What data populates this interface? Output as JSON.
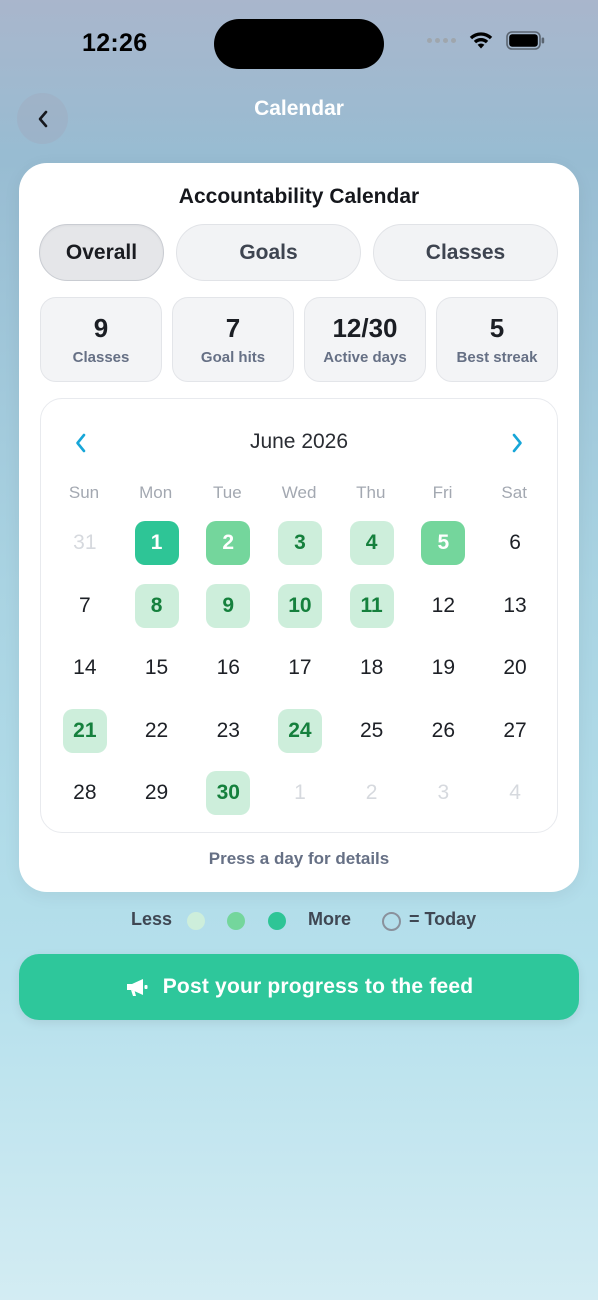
{
  "status_bar": {
    "time": "12:26"
  },
  "nav": {
    "title": "Calendar",
    "back_icon": "chevron-left-icon"
  },
  "card": {
    "title": "Accountability Calendar",
    "tabs": [
      {
        "label": "Overall",
        "active": true
      },
      {
        "label": "Goals",
        "active": false
      },
      {
        "label": "Classes",
        "active": false
      }
    ],
    "stats": [
      {
        "value": "9",
        "label": "Classes"
      },
      {
        "value": "7",
        "label": "Goal hits"
      },
      {
        "value": "12/30",
        "label": "Active days"
      },
      {
        "value": "5",
        "label": "Best streak"
      }
    ],
    "calendar": {
      "month": "June 2026",
      "weekdays": [
        "Sun",
        "Mon",
        "Tue",
        "Wed",
        "Thu",
        "Fri",
        "Sat"
      ],
      "weeks": [
        [
          {
            "d": "31",
            "s": "muted"
          },
          {
            "d": "1",
            "s": "l3"
          },
          {
            "d": "2",
            "s": "l2"
          },
          {
            "d": "3",
            "s": "l1"
          },
          {
            "d": "4",
            "s": "l1"
          },
          {
            "d": "5",
            "s": "l2"
          },
          {
            "d": "6",
            "s": "none"
          }
        ],
        [
          {
            "d": "7",
            "s": "none"
          },
          {
            "d": "8",
            "s": "l1"
          },
          {
            "d": "9",
            "s": "l1"
          },
          {
            "d": "10",
            "s": "l1"
          },
          {
            "d": "11",
            "s": "l1"
          },
          {
            "d": "12",
            "s": "none"
          },
          {
            "d": "13",
            "s": "none"
          }
        ],
        [
          {
            "d": "14",
            "s": "none"
          },
          {
            "d": "15",
            "s": "none"
          },
          {
            "d": "16",
            "s": "none"
          },
          {
            "d": "17",
            "s": "none"
          },
          {
            "d": "18",
            "s": "none"
          },
          {
            "d": "19",
            "s": "none"
          },
          {
            "d": "20",
            "s": "none"
          }
        ],
        [
          {
            "d": "21",
            "s": "l1"
          },
          {
            "d": "22",
            "s": "none"
          },
          {
            "d": "23",
            "s": "none"
          },
          {
            "d": "24",
            "s": "l1"
          },
          {
            "d": "25",
            "s": "none"
          },
          {
            "d": "26",
            "s": "none"
          },
          {
            "d": "27",
            "s": "none"
          }
        ],
        [
          {
            "d": "28",
            "s": "none"
          },
          {
            "d": "29",
            "s": "none"
          },
          {
            "d": "30",
            "s": "l1"
          },
          {
            "d": "1",
            "s": "muted"
          },
          {
            "d": "2",
            "s": "muted"
          },
          {
            "d": "3",
            "s": "muted"
          },
          {
            "d": "4",
            "s": "muted"
          }
        ]
      ],
      "hint": "Press a day for details"
    }
  },
  "legend": {
    "less": "Less",
    "more": "More",
    "today": "= Today",
    "colors": [
      "#cdeedb",
      "#74d69c",
      "#2ec596"
    ]
  },
  "post_button": {
    "label": "Post your progress to the feed",
    "icon": "megaphone-icon"
  },
  "colors": {
    "accent": "#2ec79b",
    "chevron": "#17a6d8"
  }
}
